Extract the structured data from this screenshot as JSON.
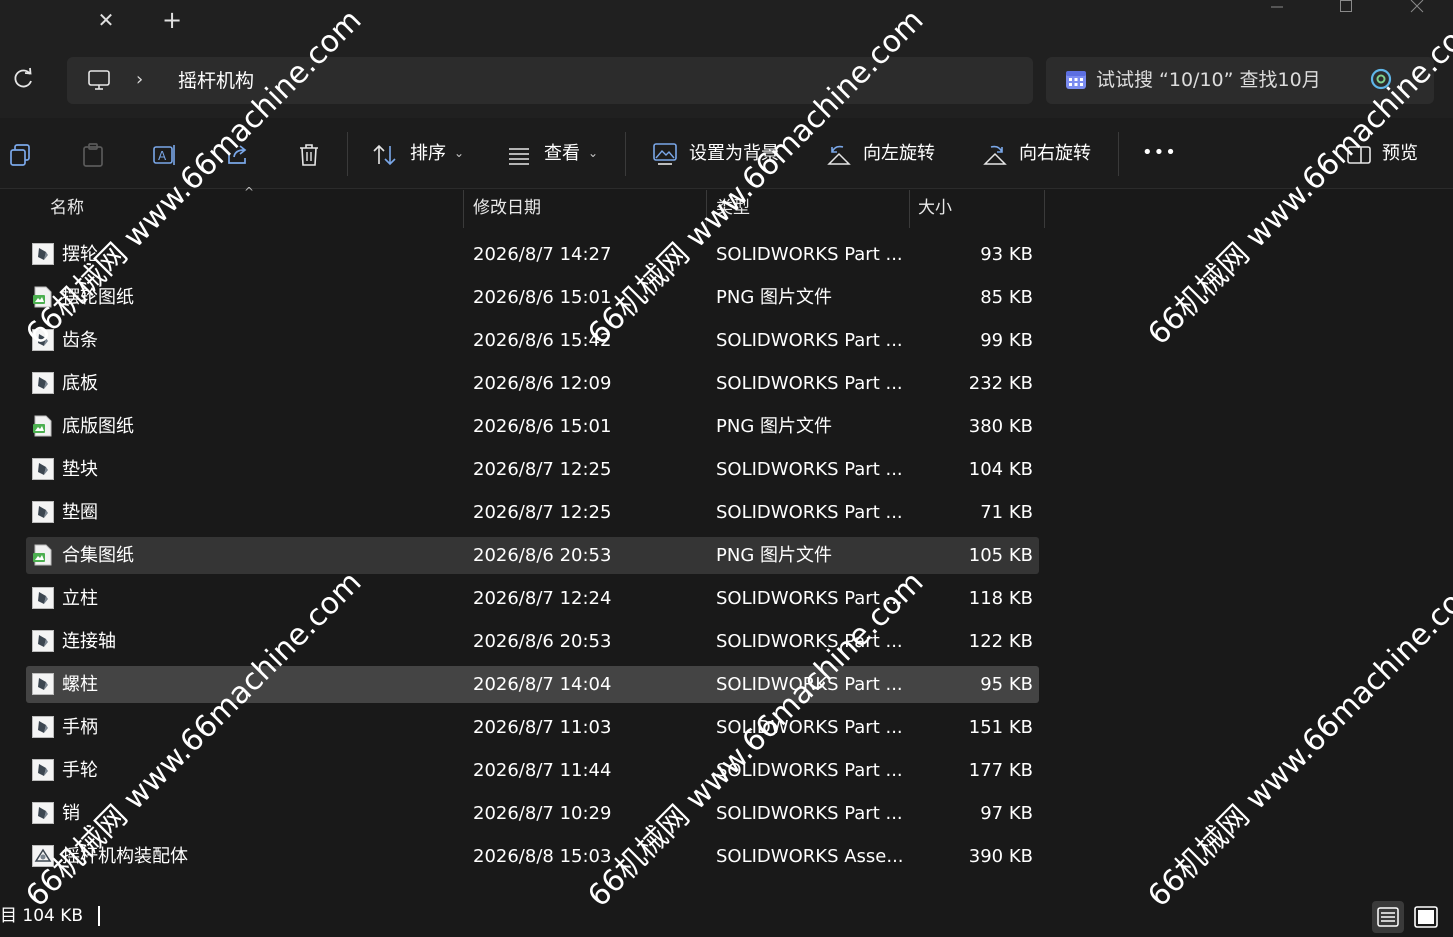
{
  "titlebar": {
    "new_tab_symbol": "+",
    "close_tab_symbol": "✕"
  },
  "address": {
    "chevron": "›",
    "folder": "摇杆机构"
  },
  "search": {
    "text": "试试搜 “10/10” 查找10月"
  },
  "toolbar": {
    "sort_label": "排序",
    "view_label": "查看",
    "set_background_label": "设置为背景",
    "rotate_left_label": "向左旋转",
    "rotate_right_label": "向右旋转",
    "more_label": "•••",
    "preview_label": "预览"
  },
  "columns": {
    "name": "名称",
    "date": "修改日期",
    "type": "类型",
    "size": "大小"
  },
  "files": [
    {
      "name": "摆轮",
      "date": "2026/8/7 14:27",
      "type": "SOLIDWORKS Part ...",
      "size": "93 KB",
      "icon": "solidworks-part-icon"
    },
    {
      "name": "摆轮图纸",
      "date": "2026/8/6 15:01",
      "type": "PNG 图片文件",
      "size": "85 KB",
      "icon": "png-image-icon"
    },
    {
      "name": "齿条",
      "date": "2026/8/6 15:42",
      "type": "SOLIDWORKS Part ...",
      "size": "99 KB",
      "icon": "solidworks-part-icon"
    },
    {
      "name": "底板",
      "date": "2026/8/6 12:09",
      "type": "SOLIDWORKS Part ...",
      "size": "232 KB",
      "icon": "solidworks-part-icon"
    },
    {
      "name": "底版图纸",
      "date": "2026/8/6 15:01",
      "type": "PNG 图片文件",
      "size": "380 KB",
      "icon": "png-image-icon"
    },
    {
      "name": "垫块",
      "date": "2026/8/7 12:25",
      "type": "SOLIDWORKS Part ...",
      "size": "104 KB",
      "icon": "solidworks-part-icon"
    },
    {
      "name": "垫圈",
      "date": "2026/8/7 12:25",
      "type": "SOLIDWORKS Part ...",
      "size": "71 KB",
      "icon": "solidworks-part-icon"
    },
    {
      "name": "合集图纸",
      "date": "2026/8/6 20:53",
      "type": "PNG 图片文件",
      "size": "105 KB",
      "icon": "png-image-icon"
    },
    {
      "name": "立柱",
      "date": "2026/8/7 12:24",
      "type": "SOLIDWORKS Part ...",
      "size": "118 KB",
      "icon": "solidworks-part-icon"
    },
    {
      "name": "连接轴",
      "date": "2026/8/6 20:53",
      "type": "SOLIDWORKS Part ...",
      "size": "122 KB",
      "icon": "solidworks-part-icon"
    },
    {
      "name": "螺柱",
      "date": "2026/8/7 14:04",
      "type": "SOLIDWORKS Part ...",
      "size": "95 KB",
      "icon": "solidworks-part-icon"
    },
    {
      "name": "手柄",
      "date": "2026/8/7 11:03",
      "type": "SOLIDWORKS Part ...",
      "size": "151 KB",
      "icon": "solidworks-part-icon"
    },
    {
      "name": "手轮",
      "date": "2026/8/7 11:44",
      "type": "SOLIDWORKS Part ...",
      "size": "177 KB",
      "icon": "solidworks-part-icon"
    },
    {
      "name": "销",
      "date": "2026/8/7 10:29",
      "type": "SOLIDWORKS Part ...",
      "size": "97 KB",
      "icon": "solidworks-part-icon"
    },
    {
      "name": "摇杆机构装配体",
      "date": "2026/8/8 15:03",
      "type": "SOLIDWORKS Asse...",
      "size": "390 KB",
      "icon": "solidworks-assembly-icon"
    }
  ],
  "status": {
    "text": "目 104 KB"
  },
  "watermark": {
    "text": "66机械网 www.66machine.com"
  },
  "colors": {
    "background": "#191919",
    "selected_row": "#353535",
    "hover_row": "#444444",
    "address_bg": "#2c2c2c"
  }
}
